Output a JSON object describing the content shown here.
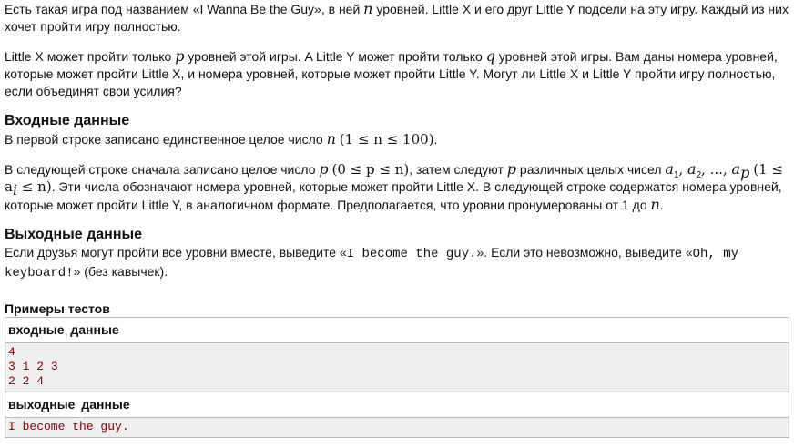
{
  "statement": {
    "p1": {
      "a": "Есть такая игра под названием «I Wanna Be the Guy», в ней ",
      "n": "n",
      "b": " уровней. Little X и его друг Little Y подсели на эту игру. Каждый из них хочет пройти игру полностью."
    },
    "p2": {
      "a": "Little X может пройти только ",
      "p": "p",
      "b": " уровней этой игры. A Little Y может пройти только ",
      "q": "q",
      "c": " уровней этой игры. Вам даны номера уровней, которые может пройти Little X, и номера уровней, которые может пройти Little Y. Могут ли Little X и Little Y пройти игру полностью, если объединят свои усилия?"
    }
  },
  "input_section": {
    "title": "Входные данные",
    "line1": {
      "a": "В первой строке записано единственное целое число ",
      "n": "n",
      "constraint": "(1 ≤ n ≤ 100)",
      "b": "."
    },
    "line2": {
      "a": "В следующей строке сначала записано целое число ",
      "p": "p",
      "constraint_p": "(0 ≤ p ≤ n)",
      "b": ", затем следуют ",
      "p2": "p",
      "c": " различных целых чисел ",
      "seq": "a",
      "sub1": "1",
      "sep1": ", ",
      "seq2": "a",
      "sub2": "2",
      "sep2": ", ..., ",
      "seq3": "a",
      "sub3": "p",
      "constraint_a": "(1 ≤ a",
      "constraint_a_sub": "i",
      "constraint_a_end": " ≤ n)",
      "d": ". Эти числа обозначают номера уровней, которые может пройти Little X. В следующей строке содержатся номера уровней, которые может пройти Little Y, в аналогичном формате. Предполагается, что уровни пронумерованы от 1 до ",
      "n": "n",
      "e": "."
    }
  },
  "output_section": {
    "title": "Выходные данные",
    "a": "Если друзья могут пройти все уровни вместе, выведите «",
    "yes": "I become the guy.",
    "b": "». Если это невозможно, выведите «",
    "no": "Oh, my keyboard!",
    "c": "» (без кавычек)."
  },
  "samples": {
    "title": "Примеры тестов",
    "input_label": "входные данные",
    "input_value": "4\n3 1 2 3\n2 2 4",
    "output_label": "выходные данные",
    "output_value": "I become the guy."
  }
}
